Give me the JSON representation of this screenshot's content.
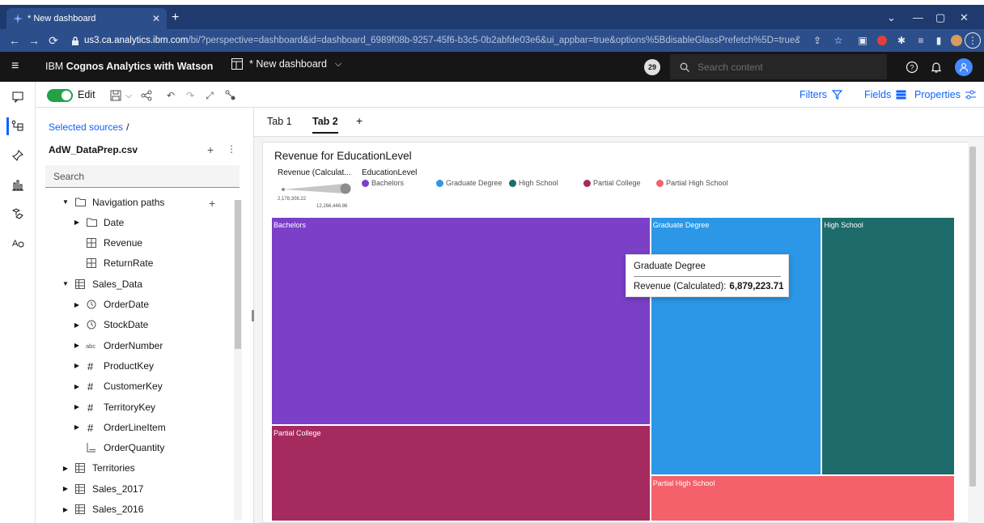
{
  "browser": {
    "tab_title": "* New dashboard",
    "url_host": "us3.ca.analytics.ibm.com",
    "url_path": "/bi/?perspective=dashboard&id=dashboard_6989f08b-9257-45f6-b3c5-0b2abfde03e6&ui_appbar=true&options%5BdisableGlassPrefetch%5D=true&..."
  },
  "app": {
    "brand_prefix": "IBM",
    "brand_name": "Cognos Analytics with Watson",
    "dashboard_name": "* New dashboard",
    "notification_count": "29",
    "search_placeholder": "Search content"
  },
  "toolbar": {
    "edit_label": "Edit",
    "filters_label": "Filters",
    "fields_label": "Fields",
    "properties_label": "Properties"
  },
  "panel": {
    "breadcrumb": "Selected sources",
    "breadcrumb_sep": "/",
    "source_name": "AdW_DataPrep.csv",
    "search_placeholder": "Search",
    "items": [
      {
        "label": "Navigation paths",
        "icon": "folder-icon",
        "caret": "down"
      },
      {
        "label": "Date",
        "icon": "folder-icon",
        "caret": "right"
      },
      {
        "label": "Revenue",
        "icon": "calculation-icon",
        "caret": "none"
      },
      {
        "label": "ReturnRate",
        "icon": "calculation-icon",
        "caret": "none"
      },
      {
        "label": "Sales_Data",
        "icon": "table-icon",
        "caret": "down"
      },
      {
        "label": "OrderDate",
        "icon": "clock-icon",
        "caret": "right"
      },
      {
        "label": "StockDate",
        "icon": "clock-icon",
        "caret": "right"
      },
      {
        "label": "OrderNumber",
        "icon": "text-field-icon",
        "caret": "right"
      },
      {
        "label": "ProductKey",
        "icon": "hash-icon",
        "caret": "right"
      },
      {
        "label": "CustomerKey",
        "icon": "hash-icon",
        "caret": "right"
      },
      {
        "label": "TerritoryKey",
        "icon": "hash-icon",
        "caret": "right"
      },
      {
        "label": "OrderLineItem",
        "icon": "hash-icon",
        "caret": "right"
      },
      {
        "label": "OrderQuantity",
        "icon": "measure-icon",
        "caret": "none"
      },
      {
        "label": "Territories",
        "icon": "table-icon",
        "caret": "right"
      },
      {
        "label": "Sales_2017",
        "icon": "table-icon",
        "caret": "right"
      },
      {
        "label": "Sales_2016",
        "icon": "table-icon",
        "caret": "right"
      }
    ]
  },
  "tabs": [
    {
      "label": "Tab 1",
      "active": false
    },
    {
      "label": "Tab 2",
      "active": true
    }
  ],
  "widget": {
    "title": "Revenue for EducationLevel",
    "size_legend_title": "Revenue (Calculat...",
    "size_legend_min": "2,178,308.22",
    "size_legend_max": "12,266,446.86",
    "color_legend_title": "EducationLevel"
  },
  "chart_data": {
    "type": "treemap",
    "title": "Revenue for EducationLevel",
    "size_measure": "Revenue (Calculat...",
    "color_dimension": "EducationLevel",
    "size_range": [
      "2,178,308.22",
      "12,266,446.86"
    ],
    "categories": [
      "Bachelors",
      "Graduate Degree",
      "High School",
      "Partial College",
      "Partial High School"
    ],
    "colors": [
      "#7b3fc8",
      "#2b97e6",
      "#1d6b6a",
      "#a52a5e",
      "#f4616a"
    ],
    "values": [
      12266446.86,
      6879223.71,
      5360000,
      5700000,
      2178308.22
    ],
    "tooltip": {
      "category": "Graduate Degree",
      "measure": "Revenue (Calculated):",
      "value": "6,879,223.71"
    }
  }
}
